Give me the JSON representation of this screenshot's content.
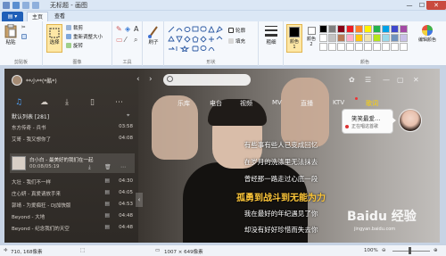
{
  "window": {
    "title": "无标题 - 画图",
    "controls": [
      "—",
      "☐",
      "✕"
    ]
  },
  "ribbon_tabs": {
    "file": "",
    "tabs": [
      "主页",
      "查看"
    ]
  },
  "ribbon": {
    "clipboard": {
      "paste": "粘贴",
      "cut": "",
      "copy": "",
      "label": "剪贴板"
    },
    "image": {
      "select": "选择",
      "crop": "裁剪",
      "resize": "重新调整大小",
      "rotate": "旋转",
      "label": "图像"
    },
    "tools": {
      "label": "工具"
    },
    "brushes": {
      "label": "刷子"
    },
    "shapes": {
      "outline": "轮廓",
      "fill": "填充",
      "label": "形状"
    },
    "size": {
      "label": "粗细"
    },
    "colors": {
      "color1": "颜色\n1",
      "color2": "颜色\n2",
      "edit": "编辑颜色",
      "label": "颜色"
    },
    "palette": [
      "#000000",
      "#7f7f7f",
      "#880015",
      "#ed1c24",
      "#ff7f27",
      "#fff200",
      "#22b14c",
      "#00a2e8",
      "#3f48cc",
      "#a349a4",
      "#ffffff",
      "#c3c3c3",
      "#b97a57",
      "#ffaec9",
      "#ffc90e",
      "#efe4b0",
      "#b5e61d",
      "#99d9ea",
      "#7092be",
      "#c8bfe7",
      "#ffffff",
      "#ffffff",
      "#ffffff",
      "#ffffff",
      "#ffffff",
      "#ffffff",
      "#ffffff",
      "#ffffff",
      "#ffffff",
      "#ffffff"
    ]
  },
  "music": {
    "username": "**小**(*酷*)",
    "nav": [
      "乐库",
      "电台",
      "视频",
      "MV",
      "直播",
      "KTV",
      "歌词"
    ],
    "active_nav": "歌词",
    "list_title": "默认列表 [281]",
    "songs": [
      {
        "name": "东方传奇 - 兵书",
        "time": "03:58"
      },
      {
        "name": "艾哥 - 我又想你了",
        "time": "04:08"
      },
      {
        "name": "大壮 - 我们不一样",
        "time": "04:30"
      },
      {
        "name": "庄心妍 - 真爱请放手来",
        "time": "04:05"
      },
      {
        "name": "郭靖 - 为爱痴狂 - DJ加快版",
        "time": "04:53"
      },
      {
        "name": "Beyond - 大地",
        "time": "04:48"
      },
      {
        "name": "Beyond - 纪念我们的天空",
        "time": "04:48"
      }
    ],
    "now_playing": {
      "name": "白小白 - 最美好的我们在一起",
      "time": "00:08/05:19"
    },
    "lyrics": [
      "有些事有些人已变成回忆",
      "在岁月的洗涤里无法抹去",
      "曾经那一路走过心底一段",
      "孤勇到战斗到无能为力",
      "我在最好的年纪遇见了你",
      "却没有好好珍惜而失去你"
    ],
    "highlight_index": 3,
    "chat": {
      "name": "笑笑最爱…",
      "status": "正在唱这首歌"
    }
  },
  "watermark": {
    "text": "Baidu 经验",
    "sub": "jingyan.baidu.com"
  },
  "status": {
    "cursor": "710, 168像素",
    "size": "1007 × 649像素",
    "zoom": "100%"
  }
}
